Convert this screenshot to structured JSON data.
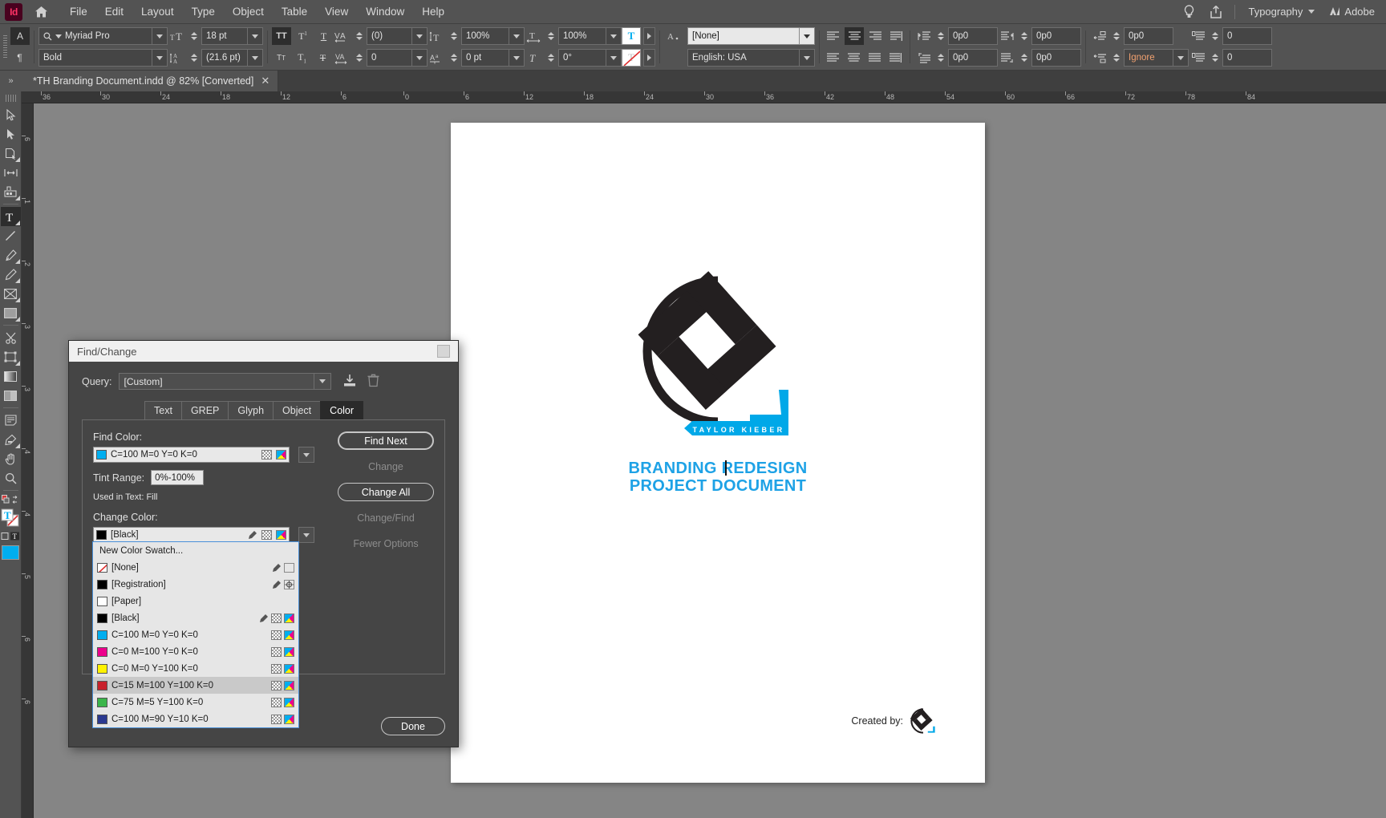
{
  "app": {
    "name": "Id",
    "workspace": "Typography",
    "account": "Adobe"
  },
  "menubar": {
    "items": [
      "File",
      "Edit",
      "Layout",
      "Type",
      "Object",
      "Table",
      "View",
      "Window",
      "Help"
    ],
    "icons": [
      "home-icon",
      "lightbulb-icon",
      "share-icon"
    ]
  },
  "control_panel": {
    "char_mode_label": "A",
    "para_mode_label": "¶",
    "font_family": "Myriad Pro",
    "font_style": "Bold",
    "font_size": "18 pt",
    "leading": "(21.6 pt)",
    "kerning": "(0)",
    "tracking": "0",
    "vertical_scale": "100%",
    "horizontal_scale": "100%",
    "baseline_shift": "0 pt",
    "skew": "0°",
    "language": "English: USA",
    "paragraph_style": "[None]",
    "left_indent": "0p0",
    "right_indent": "0p0",
    "first_line_indent": "0p0",
    "last_line_indent": "0p0",
    "space_before": "0p0",
    "space_after": "0p0",
    "hyphenation": "Ignore",
    "drop_cap_lines": "0",
    "drop_cap_chars": "0"
  },
  "tab_bar": {
    "document_tab": "*TH Branding Document.indd @ 82% [Converted]",
    "close_label": "✕",
    "panel_toggle": "»"
  },
  "toolbox": {
    "tools": [
      "selection-tool",
      "direct-selection-tool",
      "page-tool",
      "gap-tool",
      "content-collector-tool",
      "type-tool",
      "line-tool",
      "pen-tool",
      "pencil-tool",
      "frame-tool",
      "rectangle-tool",
      "scissors-tool",
      "free-transform-tool",
      "gradient-swatch-tool",
      "gradient-feather-tool",
      "note-tool",
      "eyedropper-tool",
      "hand-tool",
      "zoom-tool"
    ],
    "selected": "type-tool"
  },
  "rulers": {
    "horizontal_labels": [
      "36",
      "30",
      "24",
      "18",
      "12",
      "6",
      "0",
      "6",
      "12",
      "18",
      "24",
      "30",
      "36",
      "42",
      "48",
      "54",
      "60",
      "66",
      "72",
      "78",
      "84"
    ],
    "vertical_labels": [
      "6",
      "1",
      "2",
      "3",
      "3",
      "4",
      "4",
      "5",
      "6",
      "6"
    ],
    "zoom_level": "82%"
  },
  "document": {
    "logo_wordmark": "TAYLOR KIEBER",
    "title_line1": "BRANDING REDESIGN",
    "title_line2": "PROJECT DOCUMENT",
    "title_color": "#1ea2e6",
    "created_by_label": "Created by:"
  },
  "dialog": {
    "title": "Find/Change",
    "query_label": "Query:",
    "query_value": "[Custom]",
    "save_query_icon": "save-query-icon",
    "delete_query_icon": "trash-icon",
    "tabs": [
      {
        "label": "Text",
        "active": false
      },
      {
        "label": "GREP",
        "active": false
      },
      {
        "label": "Glyph",
        "active": false
      },
      {
        "label": "Object",
        "active": false
      },
      {
        "label": "Color",
        "active": true
      }
    ],
    "find_color_label": "Find Color:",
    "find_color_value": "C=100 M=0 Y=0 K=0",
    "find_color_hex": "#00aeef",
    "tint_range_label": "Tint Range:",
    "tint_range_value": "0%-100%",
    "used_in_text": "Used in Text: Fill",
    "change_color_label": "Change Color:",
    "change_color_value": "[Black]",
    "change_color_hex": "#000000",
    "buttons": [
      {
        "label": "Find Next",
        "state": "enabled"
      },
      {
        "label": "Change",
        "state": "disabled"
      },
      {
        "label": "Change All",
        "state": "enabled"
      },
      {
        "label": "Change/Find",
        "state": "disabled"
      },
      {
        "label": "Fewer Options",
        "state": "disabled"
      }
    ],
    "done_label": "Done",
    "swatch_dropdown": {
      "new_swatch_label": "New Color Swatch...",
      "items": [
        {
          "name": "[None]",
          "hex": "none",
          "highlighted": false,
          "eyedropper": true,
          "checker": false,
          "cmyk": true
        },
        {
          "name": "[Registration]",
          "hex": "#000000",
          "highlighted": false,
          "eyedropper": true,
          "checker": false,
          "cmyk": false,
          "registration": true
        },
        {
          "name": "[Paper]",
          "hex": "#ffffff",
          "highlighted": false,
          "eyedropper": false,
          "checker": false,
          "cmyk": false
        },
        {
          "name": "[Black]",
          "hex": "#000000",
          "highlighted": false,
          "eyedropper": true,
          "checker": true,
          "cmyk": true
        },
        {
          "name": "C=100 M=0 Y=0 K=0",
          "hex": "#00aeef",
          "highlighted": false,
          "eyedropper": false,
          "checker": true,
          "cmyk": true
        },
        {
          "name": "C=0 M=100 Y=0 K=0",
          "hex": "#ec008c",
          "highlighted": false,
          "eyedropper": false,
          "checker": true,
          "cmyk": true
        },
        {
          "name": "C=0 M=0 Y=100 K=0",
          "hex": "#fff200",
          "highlighted": false,
          "eyedropper": false,
          "checker": true,
          "cmyk": true
        },
        {
          "name": "C=15 M=100 Y=100 K=0",
          "hex": "#c8202b",
          "highlighted": true,
          "eyedropper": false,
          "checker": true,
          "cmyk": true
        },
        {
          "name": "C=75 M=5 Y=100 K=0",
          "hex": "#3bb54a",
          "highlighted": false,
          "eyedropper": false,
          "checker": true,
          "cmyk": true
        },
        {
          "name": "C=100 M=90 Y=10 K=0",
          "hex": "#2b3990",
          "highlighted": false,
          "eyedropper": false,
          "checker": true,
          "cmyk": true
        }
      ]
    }
  }
}
